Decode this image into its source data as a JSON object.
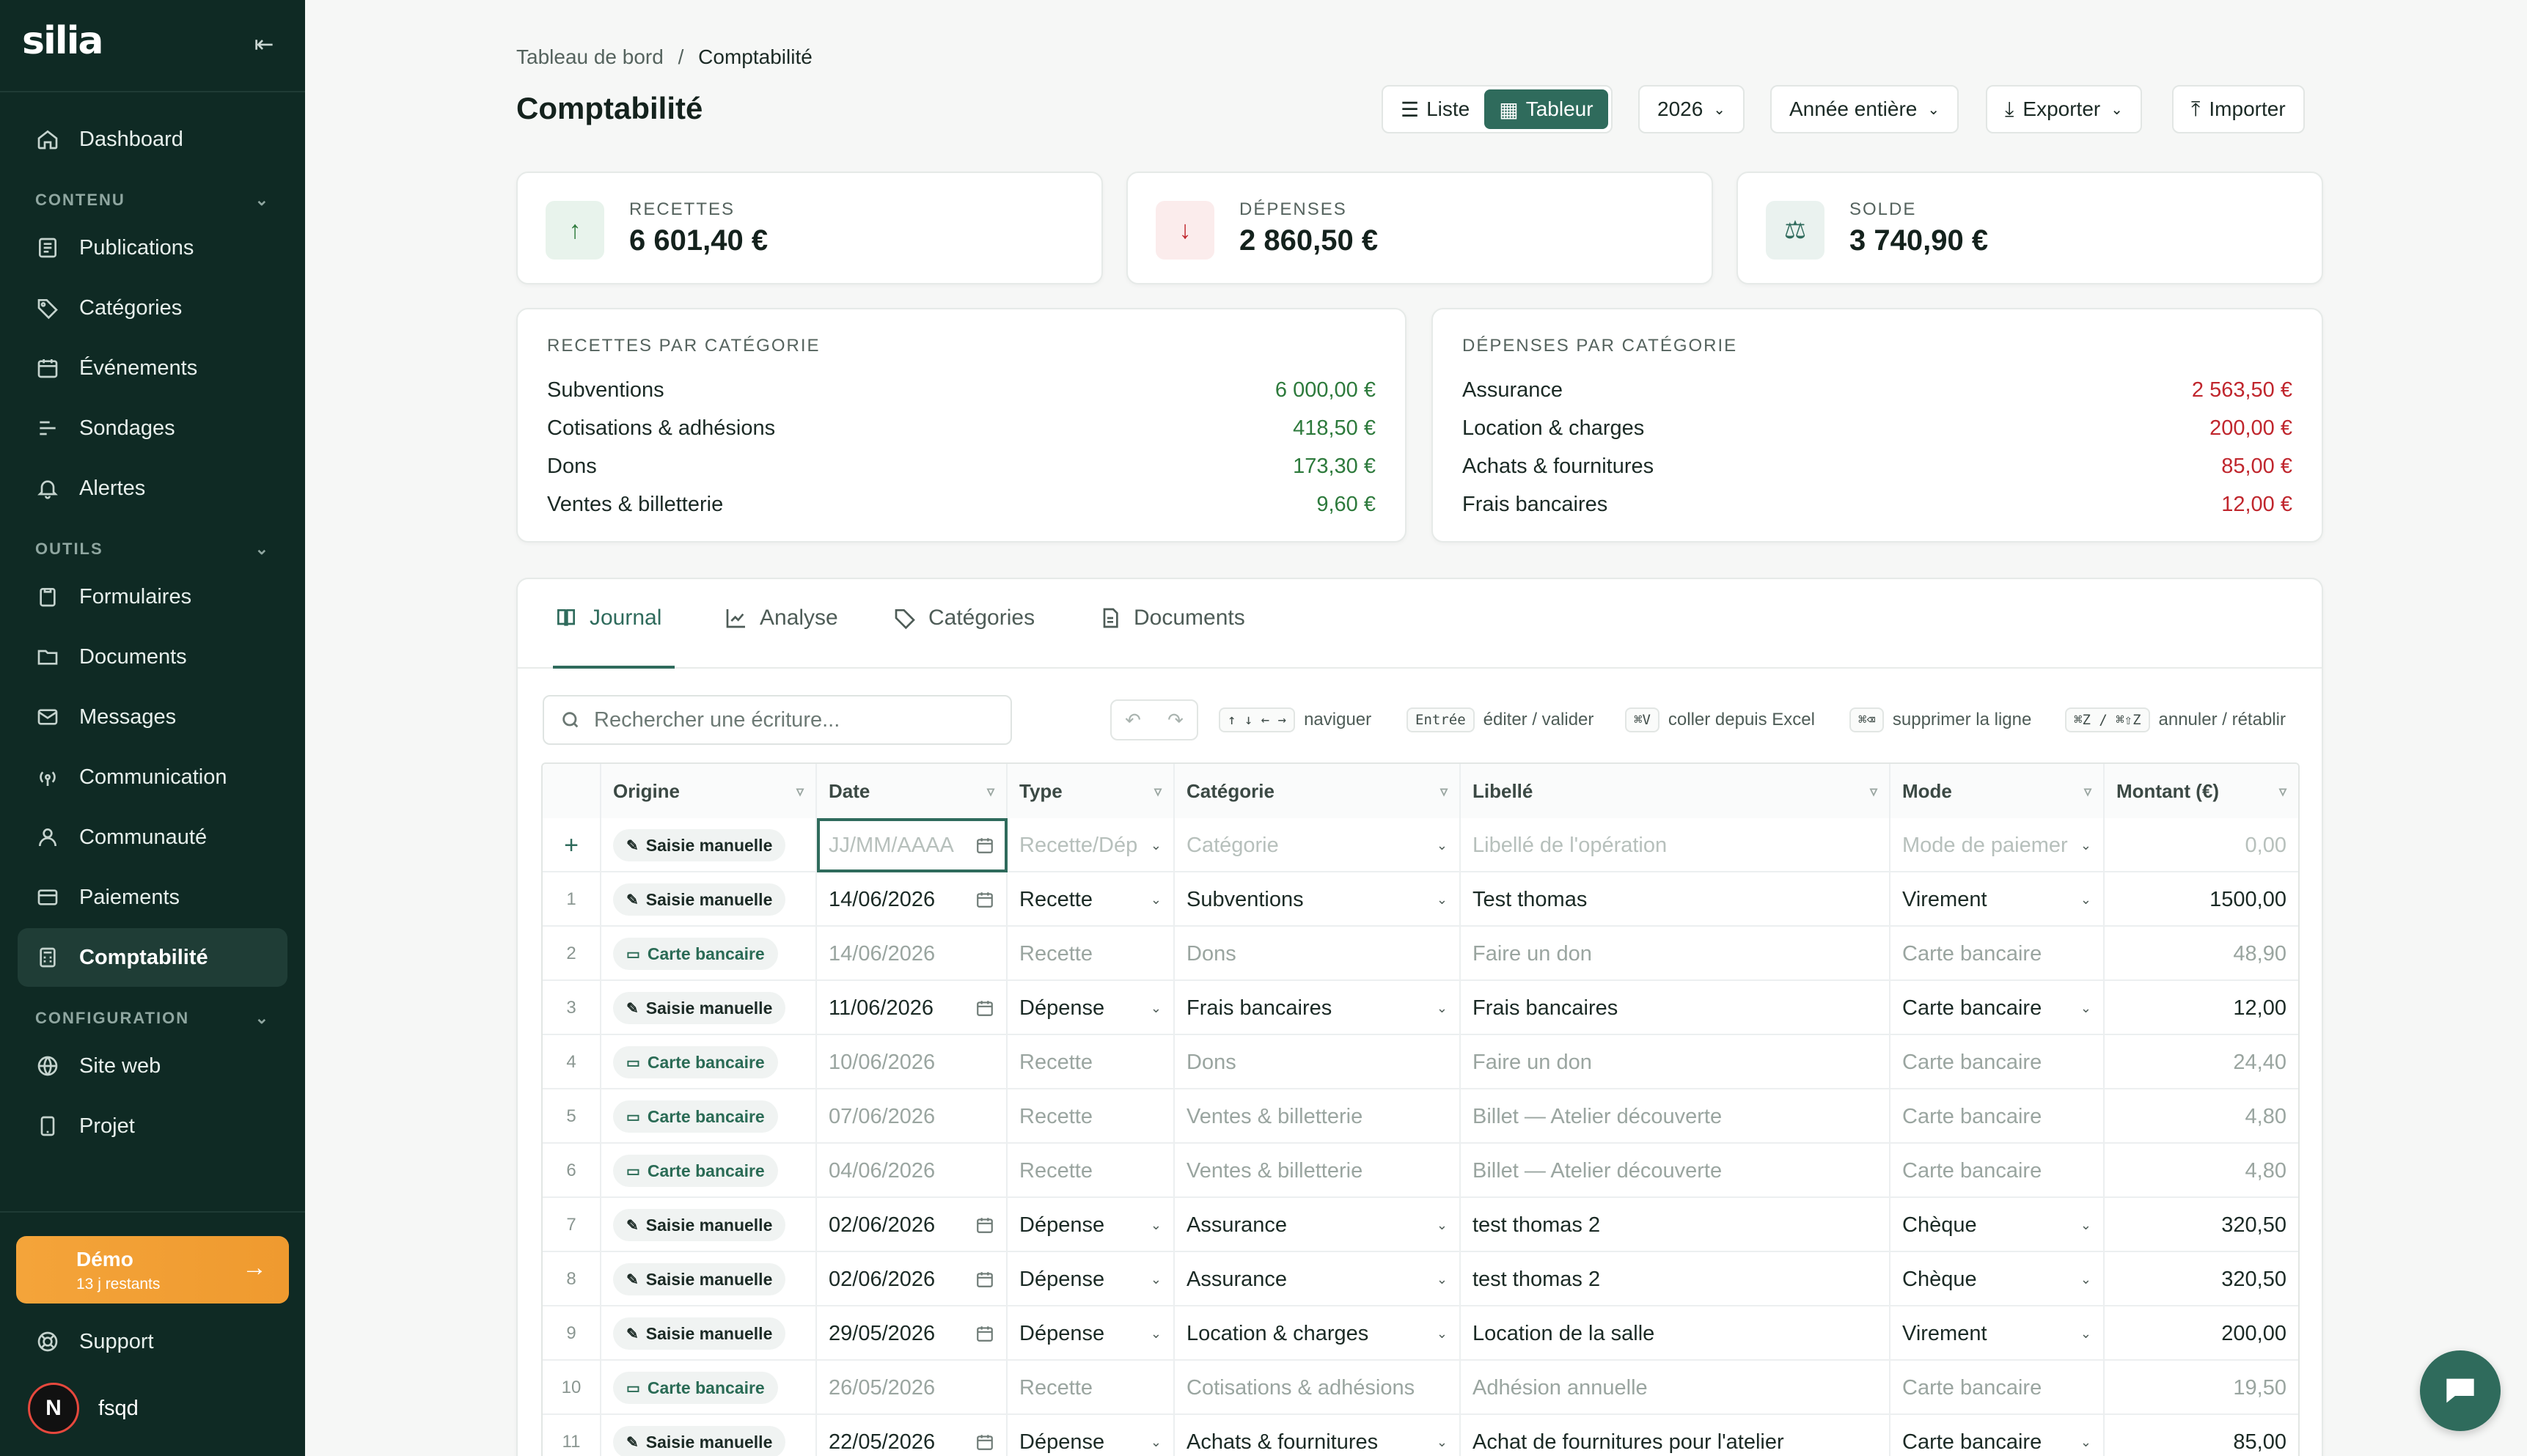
{
  "brand": "silia",
  "nav": {
    "dashboard": "Dashboard",
    "section_contenu": "CONTENU",
    "publications": "Publications",
    "categories": "Catégories",
    "evenements": "Événements",
    "sondages": "Sondages",
    "alertes": "Alertes",
    "section_outils": "OUTILS",
    "formulaires": "Formulaires",
    "documents": "Documents",
    "messages": "Messages",
    "communication": "Communication",
    "communaute": "Communauté",
    "paiements": "Paiements",
    "comptabilite": "Comptabilité",
    "section_config": "CONFIGURATION",
    "site_web": "Site web",
    "projet": "Projet",
    "support": "Support"
  },
  "demo": {
    "title": "Démo",
    "subtitle": "13 j restants"
  },
  "user": {
    "initial": "N",
    "name": "fsqd"
  },
  "breadcrumb": {
    "root": "Tableau de bord",
    "sep": "/",
    "current": "Comptabilité"
  },
  "page_title": "Comptabilité",
  "toolbar": {
    "view_list": "Liste",
    "view_sheet": "Tableur",
    "year": "2026",
    "period": "Année entière",
    "export": "Exporter",
    "import": "Importer"
  },
  "stats": {
    "recettes_label": "RECETTES",
    "recettes_value": "6 601,40 €",
    "depenses_label": "DÉPENSES",
    "depenses_value": "2 860,50 €",
    "solde_label": "SOLDE",
    "solde_value": "3 740,90 €"
  },
  "recettes_cat": {
    "title": "RECETTES PAR CATÉGORIE",
    "rows": [
      {
        "name": "Subventions",
        "amount": "6 000,00 €"
      },
      {
        "name": "Cotisations & adhésions",
        "amount": "418,50 €"
      },
      {
        "name": "Dons",
        "amount": "173,30 €"
      },
      {
        "name": "Ventes & billetterie",
        "amount": "9,60 €"
      }
    ]
  },
  "depenses_cat": {
    "title": "DÉPENSES PAR CATÉGORIE",
    "rows": [
      {
        "name": "Assurance",
        "amount": "2 563,50 €"
      },
      {
        "name": "Location & charges",
        "amount": "200,00 €"
      },
      {
        "name": "Achats & fournitures",
        "amount": "85,00 €"
      },
      {
        "name": "Frais bancaires",
        "amount": "12,00 €"
      }
    ]
  },
  "tabs": {
    "journal": "Journal",
    "analyse": "Analyse",
    "categories": "Catégories",
    "documents": "Documents"
  },
  "search_placeholder": "Rechercher une écriture...",
  "hints": {
    "nav_keys": "↑ ↓ ← →",
    "nav_text": "naviguer",
    "enter_key": "Entrée",
    "enter_text": "éditer / valider",
    "paste_key": "⌘V",
    "paste_text": "coller depuis Excel",
    "del_key": "⌘⌫",
    "del_text": "supprimer la ligne",
    "undo_key": "⌘Z / ⌘⇧Z",
    "undo_text": "annuler / rétablir"
  },
  "columns": {
    "origine": "Origine",
    "date": "Date",
    "type": "Type",
    "categorie": "Catégorie",
    "libelle": "Libellé",
    "mode": "Mode",
    "montant": "Montant (€)"
  },
  "new_row": {
    "origin": "Saisie manuelle",
    "date_ph": "JJ/MM/AAAA",
    "type_ph": "Recette/Dép",
    "cat_ph": "Catégorie",
    "libelle_ph": "Libellé de l'opération",
    "mode_ph": "Mode de paiemer",
    "amount_ph": "0,00"
  },
  "rows": [
    {
      "n": "1",
      "origin": "Saisie manuelle",
      "date": "14/06/2026",
      "type": "Recette",
      "cat": "Subventions",
      "lib": "Test thomas",
      "mode": "Virement",
      "amt": "1500,00"
    },
    {
      "n": "2",
      "origin": "Carte bancaire",
      "date": "14/06/2026",
      "type": "Recette",
      "cat": "Dons",
      "lib": "Faire un don",
      "mode": "Carte bancaire",
      "amt": "48,90"
    },
    {
      "n": "3",
      "origin": "Saisie manuelle",
      "date": "11/06/2026",
      "type": "Dépense",
      "cat": "Frais bancaires",
      "lib": "Frais bancaires",
      "mode": "Carte bancaire",
      "amt": "12,00"
    },
    {
      "n": "4",
      "origin": "Carte bancaire",
      "date": "10/06/2026",
      "type": "Recette",
      "cat": "Dons",
      "lib": "Faire un don",
      "mode": "Carte bancaire",
      "amt": "24,40"
    },
    {
      "n": "5",
      "origin": "Carte bancaire",
      "date": "07/06/2026",
      "type": "Recette",
      "cat": "Ventes & billetterie",
      "lib": "Billet — Atelier découverte",
      "mode": "Carte bancaire",
      "amt": "4,80"
    },
    {
      "n": "6",
      "origin": "Carte bancaire",
      "date": "04/06/2026",
      "type": "Recette",
      "cat": "Ventes & billetterie",
      "lib": "Billet — Atelier découverte",
      "mode": "Carte bancaire",
      "amt": "4,80"
    },
    {
      "n": "7",
      "origin": "Saisie manuelle",
      "date": "02/06/2026",
      "type": "Dépense",
      "cat": "Assurance",
      "lib": "test thomas 2",
      "mode": "Chèque",
      "amt": "320,50"
    },
    {
      "n": "8",
      "origin": "Saisie manuelle",
      "date": "02/06/2026",
      "type": "Dépense",
      "cat": "Assurance",
      "lib": "test thomas 2",
      "mode": "Chèque",
      "amt": "320,50"
    },
    {
      "n": "9",
      "origin": "Saisie manuelle",
      "date": "29/05/2026",
      "type": "Dépense",
      "cat": "Location & charges",
      "lib": "Location de la salle",
      "mode": "Virement",
      "amt": "200,00"
    },
    {
      "n": "10",
      "origin": "Carte bancaire",
      "date": "26/05/2026",
      "type": "Recette",
      "cat": "Cotisations & adhésions",
      "lib": "Adhésion annuelle",
      "mode": "Carte bancaire",
      "amt": "19,50"
    },
    {
      "n": "11",
      "origin": "Saisie manuelle",
      "date": "22/05/2026",
      "type": "Dépense",
      "cat": "Achats & fournitures",
      "lib": "Achat de fournitures pour l'atelier",
      "mode": "Carte bancaire",
      "amt": "85,00"
    }
  ]
}
